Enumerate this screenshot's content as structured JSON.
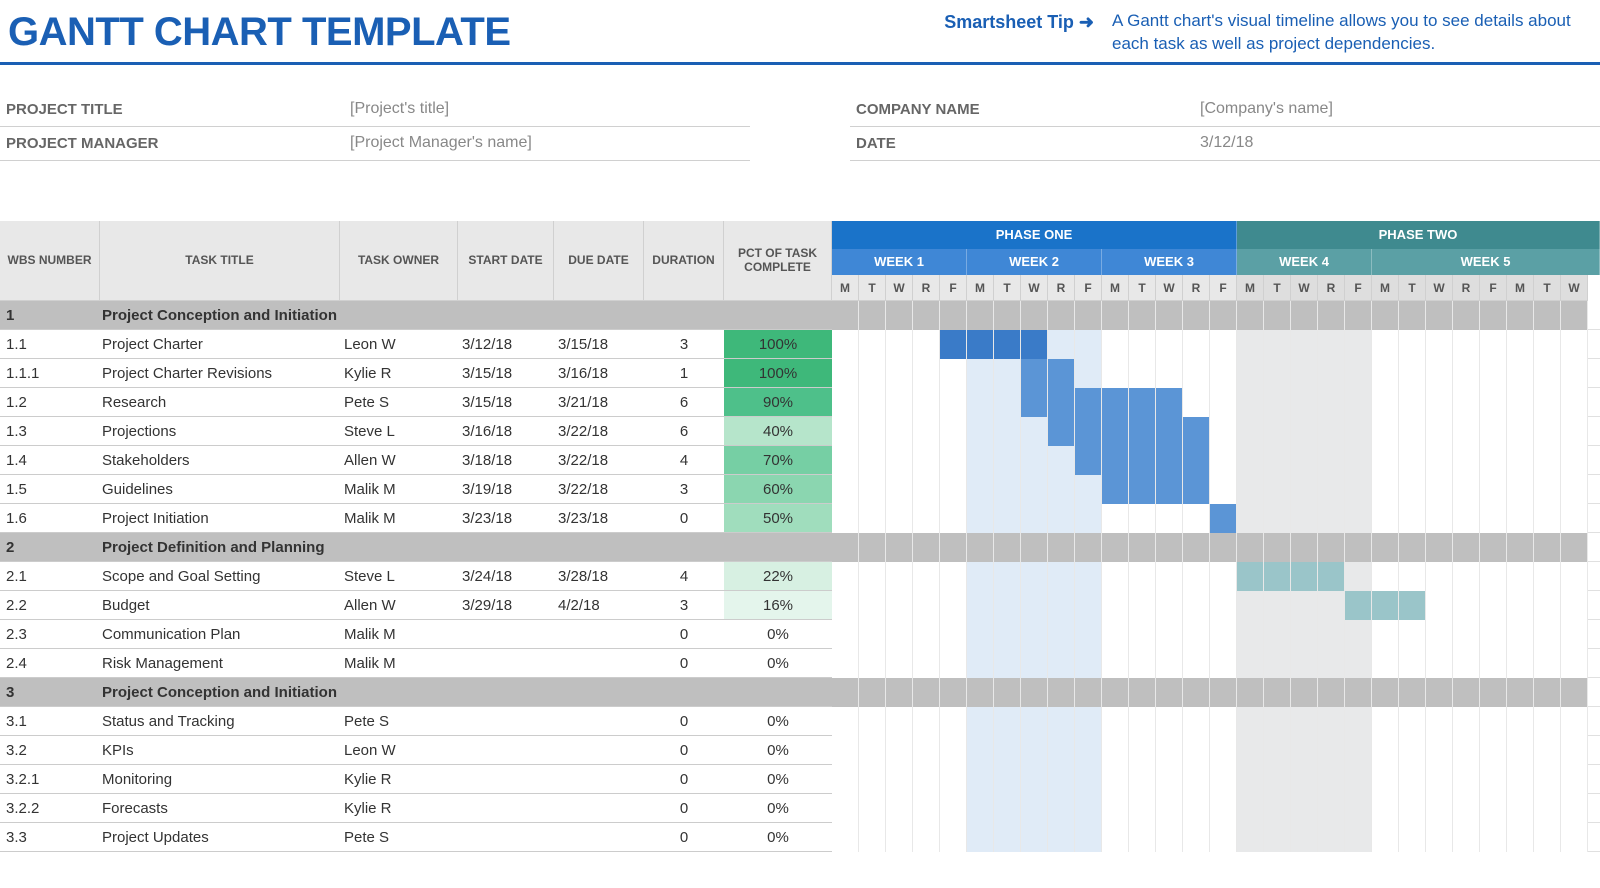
{
  "header": {
    "title": "GANTT CHART TEMPLATE",
    "tip_link": "Smartsheet Tip ➜",
    "tip_text": "A Gantt chart's visual timeline allows you to see details about each task as well as project dependencies."
  },
  "info": {
    "project_title_label": "PROJECT TITLE",
    "project_title_value": "[Project's title]",
    "project_manager_label": "PROJECT MANAGER",
    "project_manager_value": "[Project Manager's name]",
    "company_name_label": "COMPANY NAME",
    "company_name_value": "[Company's name]",
    "date_label": "DATE",
    "date_value": "3/12/18"
  },
  "columns": {
    "wbs": "WBS NUMBER",
    "title": "TASK TITLE",
    "owner": "TASK OWNER",
    "start": "START DATE",
    "due": "DUE DATE",
    "duration": "DURATION",
    "pct": "PCT OF TASK COMPLETE"
  },
  "phases": {
    "one": "PHASE ONE",
    "two": "PHASE TWO",
    "week1": "WEEK 1",
    "week2": "WEEK 2",
    "week3": "WEEK 3",
    "week4": "WEEK 4",
    "week5": "WEEK 5"
  },
  "days": [
    "M",
    "T",
    "W",
    "R",
    "F"
  ],
  "rows": [
    {
      "section": true,
      "wbs": "1",
      "title": "Project Conception and Initiation"
    },
    {
      "wbs": "1.1",
      "title": "Project Charter",
      "owner": "Leon W",
      "start": "3/12/18",
      "due": "3/15/18",
      "dur": "3",
      "pct": "100%",
      "pctClass": "pct-100",
      "barStart": 4,
      "barEnd": 7,
      "barClass": "bar-dark"
    },
    {
      "wbs": "1.1.1",
      "title": "Project Charter Revisions",
      "owner": "Kylie R",
      "start": "3/15/18",
      "due": "3/16/18",
      "dur": "1",
      "pct": "100%",
      "pctClass": "pct-100",
      "barStart": 7,
      "barEnd": 8,
      "barClass": "bar"
    },
    {
      "wbs": "1.2",
      "title": "Research",
      "owner": "Pete S",
      "start": "3/15/18",
      "due": "3/21/18",
      "dur": "6",
      "pct": "90%",
      "pctClass": "pct-90",
      "barStart": 7,
      "barEnd": 12,
      "barClass": "bar"
    },
    {
      "wbs": "1.3",
      "title": "Projections",
      "owner": "Steve L",
      "start": "3/16/18",
      "due": "3/22/18",
      "dur": "6",
      "pct": "40%",
      "pctClass": "pct-40",
      "barStart": 8,
      "barEnd": 13,
      "barClass": "bar"
    },
    {
      "wbs": "1.4",
      "title": "Stakeholders",
      "owner": "Allen W",
      "start": "3/18/18",
      "due": "3/22/18",
      "dur": "4",
      "pct": "70%",
      "pctClass": "pct-70",
      "barStart": 9,
      "barEnd": 13,
      "barClass": "bar"
    },
    {
      "wbs": "1.5",
      "title": "Guidelines",
      "owner": "Malik M",
      "start": "3/19/18",
      "due": "3/22/18",
      "dur": "3",
      "pct": "60%",
      "pctClass": "pct-60",
      "barStart": 10,
      "barEnd": 13,
      "barClass": "bar"
    },
    {
      "wbs": "1.6",
      "title": "Project Initiation",
      "owner": "Malik M",
      "start": "3/23/18",
      "due": "3/23/18",
      "dur": "0",
      "pct": "50%",
      "pctClass": "pct-50",
      "barStart": 14,
      "barEnd": 14,
      "barClass": "bar"
    },
    {
      "section": true,
      "wbs": "2",
      "title": "Project Definition and Planning"
    },
    {
      "wbs": "2.1",
      "title": "Scope and Goal Setting",
      "owner": "Steve L",
      "start": "3/24/18",
      "due": "3/28/18",
      "dur": "4",
      "pct": "22%",
      "pctClass": "pct-22",
      "barStart": 15,
      "barEnd": 18,
      "barClass": "bar-teal"
    },
    {
      "wbs": "2.2",
      "title": "Budget",
      "owner": "Allen W",
      "start": "3/29/18",
      "due": "4/2/18",
      "dur": "3",
      "pct": "16%",
      "pctClass": "pct-16",
      "barStart": 19,
      "barEnd": 21,
      "barClass": "bar-teal"
    },
    {
      "wbs": "2.3",
      "title": "Communication Plan",
      "owner": "Malik M",
      "start": "",
      "due": "",
      "dur": "0",
      "pct": "0%",
      "pctClass": "pct-0"
    },
    {
      "wbs": "2.4",
      "title": "Risk Management",
      "owner": "Malik M",
      "start": "",
      "due": "",
      "dur": "0",
      "pct": "0%",
      "pctClass": "pct-0"
    },
    {
      "section": true,
      "wbs": "3",
      "title": "Project Conception and Initiation"
    },
    {
      "wbs": "3.1",
      "title": "Status and Tracking",
      "owner": "Pete S",
      "start": "",
      "due": "",
      "dur": "0",
      "pct": "0%",
      "pctClass": "pct-0"
    },
    {
      "wbs": "3.2",
      "title": "KPIs",
      "owner": "Leon W",
      "start": "",
      "due": "",
      "dur": "0",
      "pct": "0%",
      "pctClass": "pct-0"
    },
    {
      "wbs": "3.2.1",
      "title": "Monitoring",
      "owner": "Kylie R",
      "start": "",
      "due": "",
      "dur": "0",
      "pct": "0%",
      "pctClass": "pct-0"
    },
    {
      "wbs": "3.2.2",
      "title": "Forecasts",
      "owner": "Kylie R",
      "start": "",
      "due": "",
      "dur": "0",
      "pct": "0%",
      "pctClass": "pct-0"
    },
    {
      "wbs": "3.3",
      "title": "Project Updates",
      "owner": "Pete S",
      "start": "",
      "due": "",
      "dur": "0",
      "pct": "0%",
      "pctClass": "pct-0"
    }
  ],
  "timeline": {
    "numDays": 28,
    "shadeWeek2": [
      5,
      6,
      7,
      8,
      9
    ],
    "shadeWeek4": [
      15,
      16,
      17,
      18,
      19
    ]
  }
}
